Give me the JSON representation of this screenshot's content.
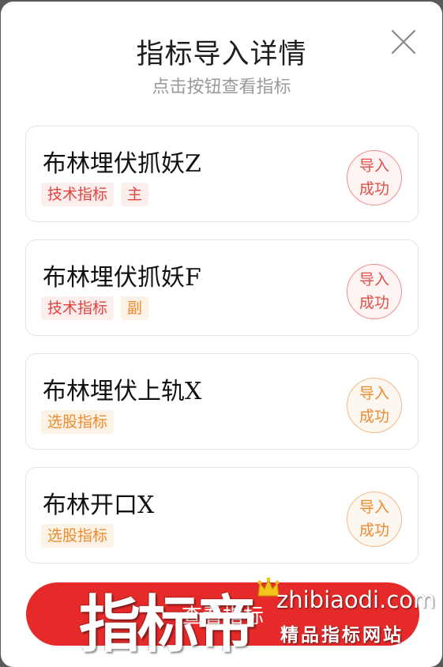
{
  "modal": {
    "title": "指标导入详情",
    "subtitle": "点击按钮查看指标"
  },
  "items": [
    {
      "name": "布林埋伏抓妖Z",
      "tags": [
        "技术指标",
        "主"
      ],
      "status": [
        "导入",
        "成功"
      ],
      "color": "#e0433c"
    },
    {
      "name": "布林埋伏抓妖F",
      "tags": [
        "技术指标",
        "副"
      ],
      "status": [
        "导入",
        "成功"
      ],
      "color": "#e0433c"
    },
    {
      "name": "布林埋伏上轨X",
      "tags": [
        "选股指标"
      ],
      "status": [
        "导入",
        "成功"
      ],
      "color": "#ef8a2c"
    },
    {
      "name": "布林开口X",
      "tags": [
        "选股指标"
      ],
      "status": [
        "导入",
        "成功"
      ],
      "color": "#ef8a2c"
    }
  ],
  "bottom_button": {
    "label": "查看指标"
  },
  "watermark": {
    "brand": "指标帝",
    "url": "zhibiaodi.com",
    "slogan": "精品指标网站"
  },
  "colors": {
    "accent_red": "#e62a2a",
    "tag_red": "#e0433c",
    "tag_orange": "#ef8a2c"
  }
}
